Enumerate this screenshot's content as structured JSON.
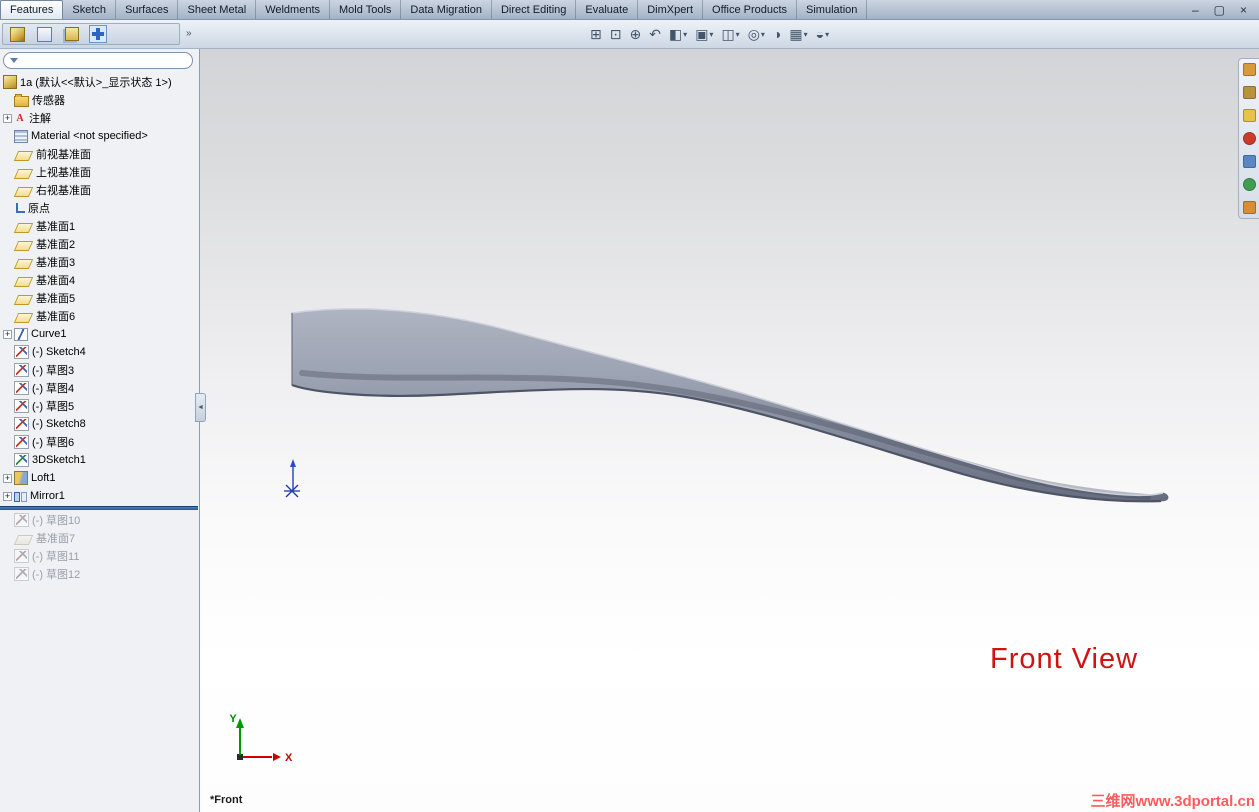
{
  "menu_tabs": [
    {
      "label": "Features",
      "active": true
    },
    {
      "label": "Sketch"
    },
    {
      "label": "Surfaces"
    },
    {
      "label": "Sheet Metal"
    },
    {
      "label": "Weldments"
    },
    {
      "label": "Mold Tools"
    },
    {
      "label": "Data Migration"
    },
    {
      "label": "Direct Editing"
    },
    {
      "label": "Evaluate"
    },
    {
      "label": "DimXpert"
    },
    {
      "label": "Office Products"
    },
    {
      "label": "Simulation"
    }
  ],
  "window_controls": [
    {
      "name": "minimize-icon",
      "glyph": "–"
    },
    {
      "name": "restore-icon",
      "glyph": "▢"
    },
    {
      "name": "close-icon",
      "glyph": "×"
    }
  ],
  "panel_tabs": [
    {
      "name": "featuremanager-tab-icon",
      "active": false
    },
    {
      "name": "propertymanager-tab-icon",
      "active": false
    },
    {
      "name": "configurationmanager-tab-icon",
      "active": false
    },
    {
      "name": "dimxpertmanager-tab-icon",
      "active": true
    }
  ],
  "view_toolbar": [
    {
      "name": "zoom-to-fit-icon",
      "dropdown": false
    },
    {
      "name": "zoom-area-icon",
      "dropdown": false
    },
    {
      "name": "zoom-in-out-icon",
      "dropdown": false
    },
    {
      "name": "previous-view-icon",
      "dropdown": false
    },
    {
      "name": "section-view-icon",
      "dropdown": true
    },
    {
      "name": "view-orientation-icon",
      "dropdown": true
    },
    {
      "name": "display-style-icon",
      "dropdown": true
    },
    {
      "name": "hide-show-items-icon",
      "dropdown": true
    },
    {
      "name": "edit-appearance-icon",
      "dropdown": false
    },
    {
      "name": "apply-scene-icon",
      "dropdown": true
    },
    {
      "name": "view-settings-icon",
      "dropdown": true
    }
  ],
  "feature_tree": {
    "overflow_chevron": "»",
    "filter_placeholder": "",
    "filter_value": "",
    "items": [
      {
        "label": "1a (默认<<默认>_显示状态 1>)",
        "icon": "part-icon",
        "root": true
      },
      {
        "label": "传感器",
        "icon": "sensors-folder-icon"
      },
      {
        "label": "注解",
        "icon": "annotations-icon",
        "expandable": true
      },
      {
        "label": "Material <not specified>",
        "icon": "material-icon"
      },
      {
        "label": "前视基准面",
        "icon": "plane-icon"
      },
      {
        "label": "上视基准面",
        "icon": "plane-icon"
      },
      {
        "label": "右视基准面",
        "icon": "plane-icon"
      },
      {
        "label": "原点",
        "icon": "origin-icon"
      },
      {
        "label": "基准面1",
        "icon": "plane-icon"
      },
      {
        "label": "基准面2",
        "icon": "plane-icon"
      },
      {
        "label": "基准面3",
        "icon": "plane-icon"
      },
      {
        "label": "基准面4",
        "icon": "plane-icon"
      },
      {
        "label": "基准面5",
        "icon": "plane-icon"
      },
      {
        "label": "基准面6",
        "icon": "plane-icon"
      },
      {
        "label": "Curve1",
        "icon": "curve-icon",
        "expandable": true
      },
      {
        "label": "(-) Sketch4",
        "icon": "sketch-icon"
      },
      {
        "label": "(-) 草图3",
        "icon": "sketch-icon"
      },
      {
        "label": "(-) 草图4",
        "icon": "sketch-icon"
      },
      {
        "label": "(-) 草图5",
        "icon": "sketch-icon"
      },
      {
        "label": "(-) Sketch8",
        "icon": "sketch-icon"
      },
      {
        "label": "(-) 草图6",
        "icon": "sketch-icon"
      },
      {
        "label": "3DSketch1",
        "icon": "sketch3d-icon"
      },
      {
        "label": "Loft1",
        "icon": "loft-icon",
        "expandable": true
      },
      {
        "label": "Mirror1",
        "icon": "mirror-icon",
        "expandable": true
      },
      {
        "type": "rollback"
      },
      {
        "label": "(-) 草图10",
        "icon": "sketch-icon",
        "grayed": true
      },
      {
        "label": "基准面7",
        "icon": "plane-icon",
        "grayed": true
      },
      {
        "label": "(-) 草图11",
        "icon": "sketch-icon",
        "grayed": true
      },
      {
        "label": "(-) 草图12",
        "icon": "sketch-icon",
        "grayed": true
      }
    ]
  },
  "task_pane": [
    {
      "name": "taskpane-home-icon",
      "color": "#d99a3e"
    },
    {
      "name": "taskpane-design-library-icon",
      "color": "#b9933c"
    },
    {
      "name": "taskpane-file-explorer-icon",
      "color": "#e8c24a"
    },
    {
      "name": "taskpane-search-icon",
      "color": "#cf3a28"
    },
    {
      "name": "taskpane-view-palette-icon",
      "color": "#5b86c4"
    },
    {
      "name": "taskpane-appearances-icon",
      "color": "#3f9e4e"
    },
    {
      "name": "taskpane-custom-properties-icon",
      "color": "#d88c35"
    }
  ],
  "viewport": {
    "view_label": "Front View",
    "orientation_indicator": "*Front",
    "watermark": "三维网www.3dportal.cn",
    "triad": {
      "x_label": "X",
      "y_label": "Y"
    }
  },
  "splitter_chevron": "◄",
  "colors": {
    "view_label": "#ce1312",
    "watermark": "#ff5b5b",
    "rollback_bar": "#2e5f9e",
    "model_top": "#aeb4c1",
    "model_bottom": "#666d7f"
  }
}
